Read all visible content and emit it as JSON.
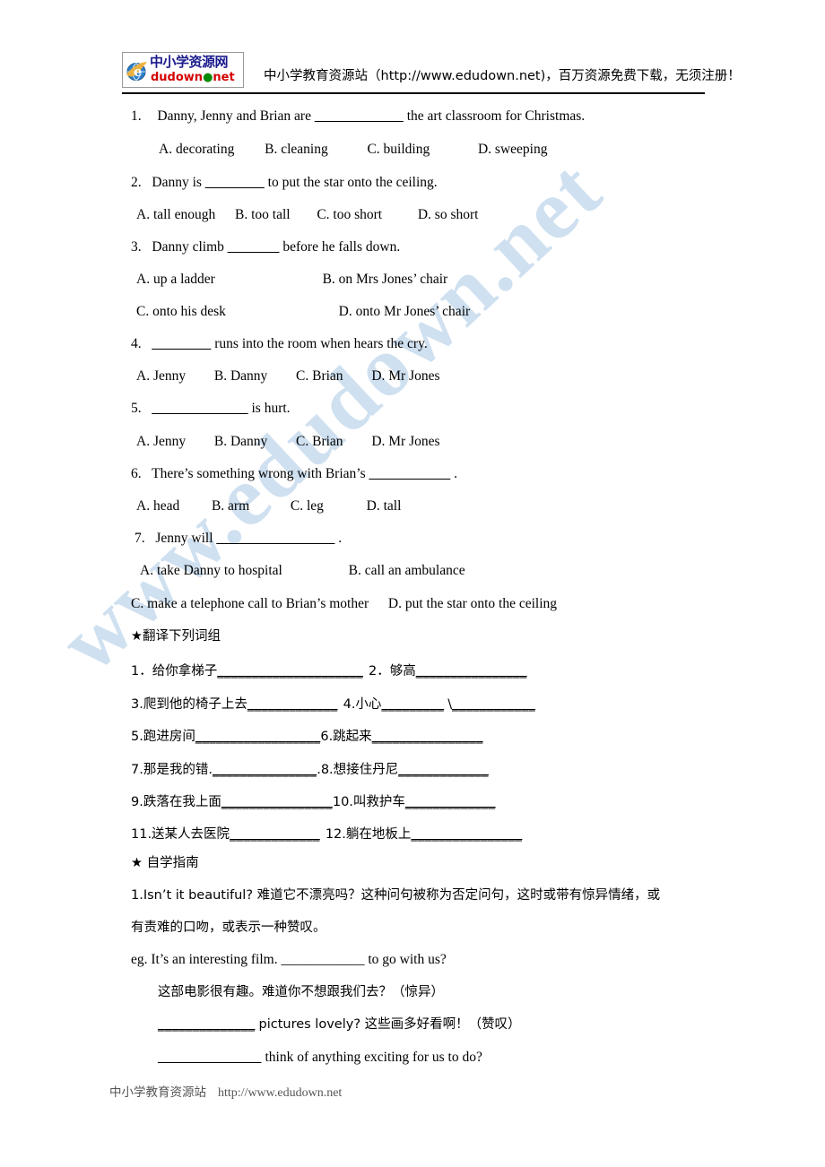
{
  "header": {
    "logo": {
      "icon": "ie-globe-icon",
      "cn_text": "中小学资源网",
      "en_text": "dudown",
      "en_dot": "●",
      "en_net": "net"
    },
    "tagline": "中小学教育资源站（http://www.edudown.net)，百万资源免费下载，无须注册！"
  },
  "watermark": {
    "text": "www.edudown.net",
    "color": "#cddff0"
  },
  "multiple_choice": [
    {
      "number": "1.",
      "stem_before": "Danny, Jenny and Brian are",
      "blank": "____________",
      "stem_after": "the art classroom for Christmas.",
      "options": [
        "A. decorating",
        "B. cleaning",
        "C. building",
        "D. sweeping"
      ]
    },
    {
      "number": "2.",
      "stem_before": "Danny is",
      "blank": "________",
      "stem_after": "to put the star onto the ceiling.",
      "options": [
        "A. tall enough",
        "B. too tall",
        "C. too short",
        "D. so short"
      ]
    },
    {
      "number": "3.",
      "stem_before": "Danny climb",
      "blank": "_______",
      "stem_after": "before he falls down.",
      "options": [
        "A. up a ladder",
        "B. on Mrs Jones’ chair",
        "C. onto his desk",
        "D. onto Mr Jones’ chair"
      ]
    },
    {
      "number": "4.",
      "stem_before": "",
      "blank": "________",
      "stem_after": "runs into the room when hears the cry.",
      "options": [
        "A. Jenny",
        "B. Danny",
        "C. Brian",
        "D. Mr Jones"
      ]
    },
    {
      "number": "5.",
      "stem_before": "",
      "blank": "_____________",
      "stem_after": "is hurt.",
      "options": [
        "A. Jenny",
        "B. Danny",
        "C. Brian",
        "D. Mr Jones"
      ]
    },
    {
      "number": "6.",
      "stem_before": "There’s something wrong with Brian’s",
      "blank": "___________",
      "stem_after": ".",
      "options": [
        "A. head",
        "B. arm",
        "C. leg",
        "D. tall"
      ]
    },
    {
      "number": "7.",
      "stem_before": "Jenny will",
      "blank": "________________",
      "stem_after": ".",
      "options": [
        "A. take Danny to hospital",
        "B. call an ambulance",
        "C. make a telephone call to Brian’s mother",
        "D. put the star onto the ceiling"
      ]
    }
  ],
  "translate_section": {
    "heading": "★翻译下列词组",
    "items": [
      {
        "label": "1．给你拿梯子",
        "blank": "_____________________"
      },
      {
        "label": "2．够高",
        "blank": "________________"
      },
      {
        "label": "3.爬到他的椅子上去",
        "blank": "_____________"
      },
      {
        "label": "4.小心",
        "blank": "_________",
        "extra_sep": "\\",
        "extra_blank": "____________"
      },
      {
        "label": "5.跑进房间",
        "blank": "__________________"
      },
      {
        "label": "6.跳起来",
        "blank": "________________"
      },
      {
        "label": "7.那是我的错.",
        "blank": "_______________",
        "trailing": "."
      },
      {
        "label": "8.想接住丹尼",
        "blank": "_____________"
      },
      {
        "label": "9.跌落在我上面",
        "blank": "________________"
      },
      {
        "label": "10.叫救护车",
        "blank": "_____________"
      },
      {
        "label": "11.送某人去医院",
        "blank": "_____________"
      },
      {
        "label": "12.躺在地板上",
        "blank": "________________"
      }
    ]
  },
  "guide_section": {
    "heading": "★  自学指南",
    "point1_line1": "1.Isn’t it beautiful?   难道它不漂亮吗？这种问句被称为否定问句，这时或带有惊异情绪，或",
    "point1_line2": "有责难的口吻，或表示一种赞叹。",
    "eg_line": "eg. It’s an interesting film. ____________ to go with us?",
    "eg_cn": "这部电影很有趣。难道你不想跟我们去？（惊异）",
    "ex2_blank": "______________",
    "ex2_text": "pictures lovely? 这些画多好看啊！（赞叹）",
    "ex3_blank": "______________",
    "ex3_text": "think of anything exciting for us to do?"
  },
  "footer": {
    "cn": "中小学教育资源站",
    "url": "http://www.edudown.net"
  }
}
